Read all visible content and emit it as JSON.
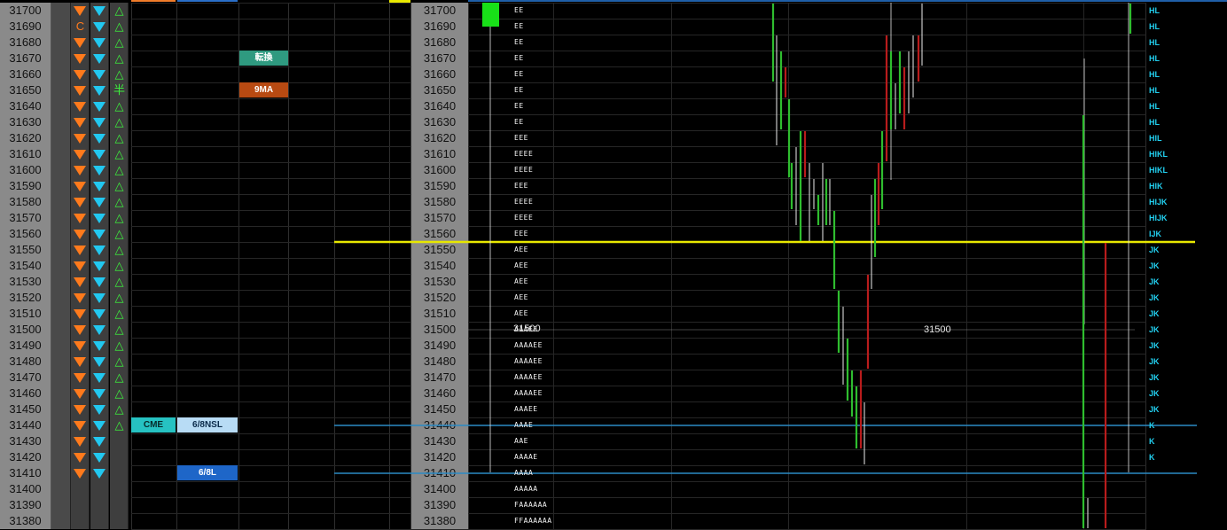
{
  "ladder": {
    "prices": [
      "31700",
      "31690",
      "31680",
      "31670",
      "31660",
      "31650",
      "31640",
      "31630",
      "31620",
      "31610",
      "31600",
      "31590",
      "31580",
      "31570",
      "31560",
      "31550",
      "31540",
      "31530",
      "31520",
      "31510",
      "31500",
      "31490",
      "31480",
      "31470",
      "31460",
      "31450",
      "31440",
      "31430",
      "31420",
      "31410",
      "31400",
      "31390",
      "31380"
    ],
    "special_marks": {
      "31690": "C",
      "31650": "半"
    }
  },
  "tags": {
    "tenkan": {
      "label": "転換",
      "color": "#2f9a80"
    },
    "nine_ma": {
      "label": "9MA",
      "color": "#b84a12"
    },
    "cme": {
      "label": "CME",
      "color": "#26c2c2"
    },
    "nsl": {
      "label": "6/8NSL",
      "color": "#b8dcf5"
    },
    "ldate": {
      "label": "6/8L",
      "color": "#1e66c8"
    }
  },
  "tpo_profile": {
    "31700": "EE",
    "31690": "EE",
    "31680": "EE",
    "31670": "EE",
    "31660": "EE",
    "31650": "EE",
    "31640": "EE",
    "31630": "EE",
    "31620": "EEE",
    "31610": "EEEE",
    "31600": "EEEE",
    "31590": "EEE",
    "31580": "EEEE",
    "31570": "EEEE",
    "31560": "EEE",
    "31550": "AEE",
    "31540": "AEE",
    "31530": "AEE",
    "31520": "AEE",
    "31510": "AEE",
    "31500": "AAAEE",
    "31490": "AAAAEE",
    "31480": "AAAAEE",
    "31470": "AAAAEE",
    "31460": "AAAAEE",
    "31450": "AAAEE",
    "31440": "AAAE",
    "31430": "AAE",
    "31420": "AAAAE",
    "31410": "AAAA",
    "31400": "AAAAA",
    "31390": "FAAAAAA",
    "31380": "FFAAAAAA"
  },
  "right_labels": {
    "31700": "HL",
    "31690": "HL",
    "31680": "HL",
    "31670": "HL",
    "31660": "HL",
    "31650": "HL",
    "31640": "HL",
    "31630": "HL",
    "31620": "HIL",
    "31610": "HIKL",
    "31600": "HIKL",
    "31590": "HIK",
    "31580": "HIJK",
    "31570": "HIJK",
    "31560": "IJK",
    "31550": "JK",
    "31540": "JK",
    "31530": "JK",
    "31520": "JK",
    "31510": "JK",
    "31500": "JK",
    "31490": "JK",
    "31480": "JK",
    "31470": "JK",
    "31460": "JK",
    "31450": "JK",
    "31440": "K",
    "31430": "K",
    "31420": "K"
  },
  "price_lines": {
    "round_line_label": "31500",
    "round_line_label_left": "31500",
    "yellow_line_price": "31555",
    "blue_line_1_price": "31440",
    "blue_line_2_price": "31410"
  },
  "colors": {
    "up": "#2fbd2f",
    "down": "#b81c1c",
    "yellow": "#e8e800",
    "blue_line": "#2a8ac4",
    "highlight": "#18e018"
  }
}
